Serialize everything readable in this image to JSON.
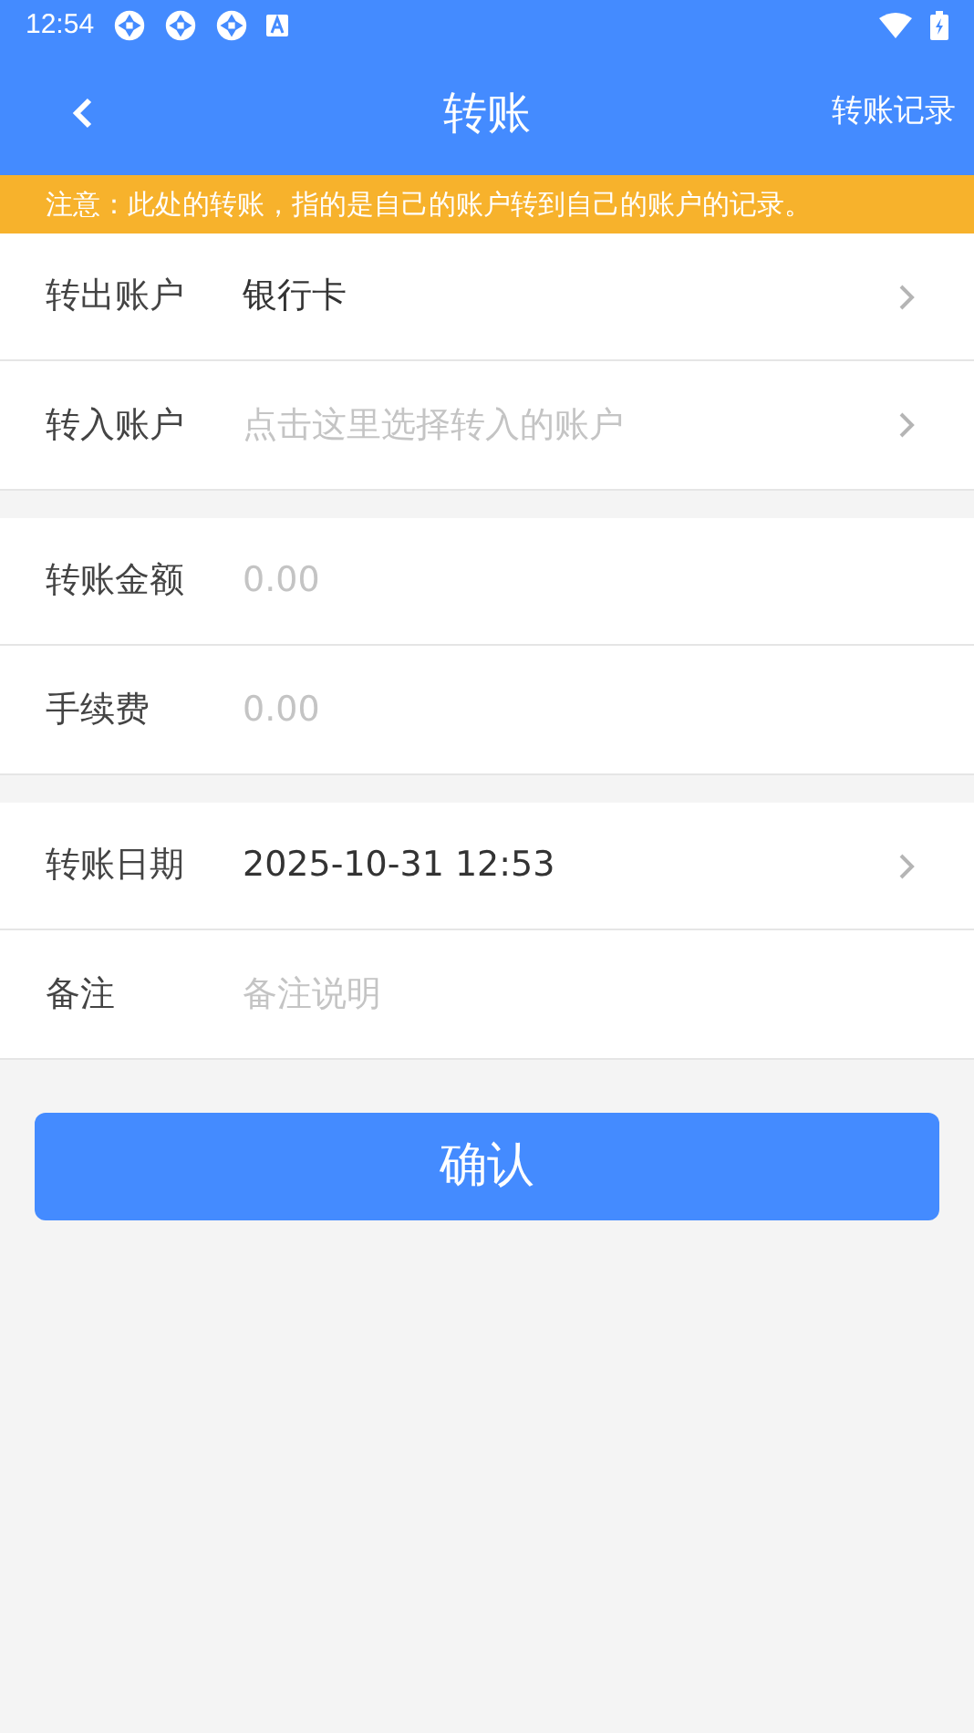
{
  "status_bar": {
    "time": "12:54"
  },
  "header": {
    "title": "转账",
    "action": "转账记录"
  },
  "notice": "注意：此处的转账，指的是自己的账户转到自己的账户的记录。",
  "groups": [
    {
      "rows": [
        {
          "kind": "select",
          "label": "转出账户",
          "value": "银行卡"
        },
        {
          "kind": "select",
          "label": "转入账户",
          "placeholder": "点击这里选择转入的账户"
        }
      ]
    },
    {
      "rows": [
        {
          "kind": "input",
          "label": "转账金额",
          "placeholder": "0.00"
        },
        {
          "kind": "input",
          "label": "手续费",
          "placeholder": "0.00"
        }
      ]
    },
    {
      "rows": [
        {
          "kind": "select",
          "label": "转账日期",
          "value": "2025-10-31 12:53"
        },
        {
          "kind": "input",
          "label": "备注",
          "placeholder": "备注说明"
        }
      ]
    }
  ],
  "confirm_button": "确认"
}
